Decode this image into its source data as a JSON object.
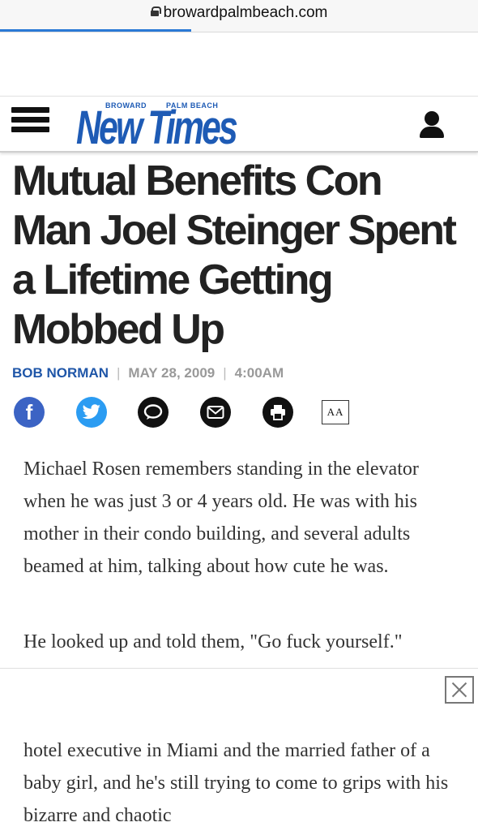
{
  "browser": {
    "url": "browardpalmbeach.com",
    "load_progress": 0.4
  },
  "site": {
    "logo_top_left": "BROWARD",
    "logo_top_right": "PALM BEACH",
    "logo_main": "New Times"
  },
  "article": {
    "headline": "Mutual Benefits Con Man Joel Steinger Spent a Lifetime Getting Mobbed Up",
    "author": "BOB NORMAN",
    "date": "MAY 28, 2009",
    "time": "4:00AM",
    "font_size_label": "AA",
    "paragraphs": [
      "Michael Rosen remembers standing in the elevator when he was just 3 or 4 years old. He was with his mother in their condo building, and several adults beamed at him, talking about how cute he was.",
      "He looked up and told them, \"Go fuck yourself.\"",
      "hotel executive in Miami and the married father of a baby girl, and he's still trying to come to grips with his bizarre and chaotic"
    ]
  },
  "share_icons": [
    "facebook-icon",
    "twitter-icon",
    "comment-icon",
    "email-icon",
    "print-icon"
  ],
  "colors": {
    "brand_blue": "#1e5bb5",
    "author_blue": "#1f56a8",
    "facebook": "#3b63c4",
    "twitter": "#2b9cf2"
  }
}
